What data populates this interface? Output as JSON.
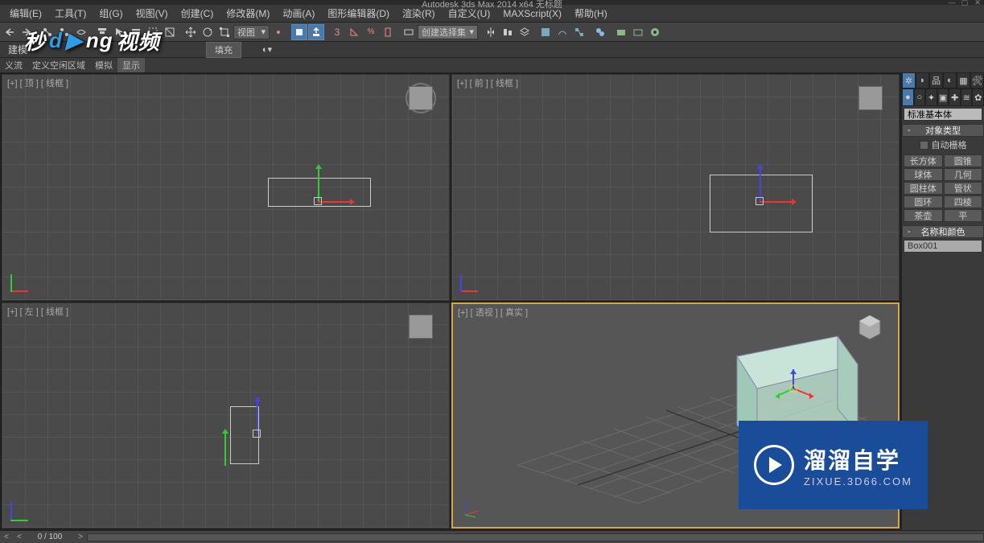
{
  "title": "Autodesk 3ds Max 2014 x64   无标题",
  "menus": [
    "编辑(E)",
    "工具(T)",
    "组(G)",
    "视图(V)",
    "创建(C)",
    "修改器(M)",
    "动画(A)",
    "图形编辑器(D)",
    "渲染(R)",
    "自定义(U)",
    "MAXScript(X)",
    "帮助(H)"
  ],
  "second_tabs": {
    "left": "建模",
    "fill": "填充"
  },
  "third_tabs": [
    "义流",
    "定义空闲区域",
    "模拟",
    "显示"
  ],
  "view_dropdown": "视图",
  "selection_dropdown": "创建选择集",
  "viewports": {
    "top": "[+] [ 顶 ] [ 线框 ]",
    "front": "[+] [ 前 ] [ 线框 ]",
    "left": "[+] [ 左 ] [ 线框 ]",
    "persp": "[+] [ 透视 ] [ 真实 ]"
  },
  "command_panel": {
    "category": "标准基本体",
    "rollout_objtype": "对象类型",
    "autogrid_label": "自动栅格",
    "buttons_left": [
      "长方体",
      "球体",
      "圆柱体",
      "圆环",
      "茶壶"
    ],
    "buttons_right": [
      "圆锥",
      "几何",
      "管状",
      "四棱",
      "平"
    ],
    "rollout_name": "名称和颜色",
    "object_name": "Box001"
  },
  "timeline": {
    "frame": "0 / 100"
  },
  "overlay_logo": {
    "t1": "秒",
    "t2": "d",
    "t3": "ng",
    "t4": "视频"
  },
  "overlay_brand": {
    "main": "溜溜自学",
    "sub": "ZIXUE.3D66.COM"
  }
}
